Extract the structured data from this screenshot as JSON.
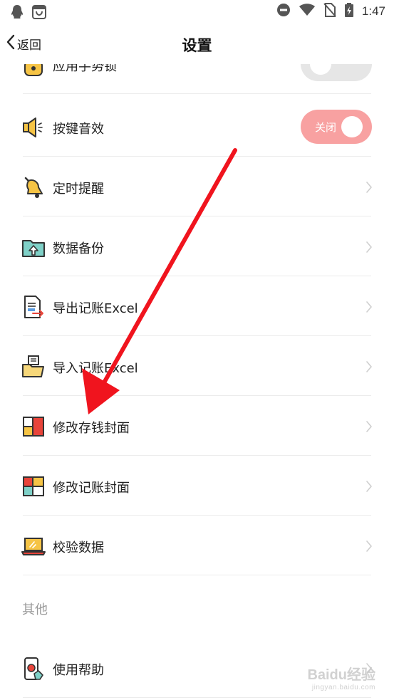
{
  "status_bar": {
    "time": "1:47",
    "icons": [
      "qq-icon",
      "shopping-bag-icon",
      "do-not-disturb-icon",
      "wifi-icon",
      "no-sim-icon",
      "battery-charging-icon"
    ]
  },
  "nav": {
    "back_label": "返回",
    "title": "设置"
  },
  "rows": [
    {
      "label": "应用手势锁",
      "icon": "lock-icon",
      "control": "toggle"
    },
    {
      "label": "按键音效",
      "icon": "speaker-icon",
      "control": "toggle",
      "toggle_text": "关闭"
    },
    {
      "label": "定时提醒",
      "icon": "bell-icon",
      "control": "chevron"
    },
    {
      "label": "数据备份",
      "icon": "folder-upload-icon",
      "control": "chevron"
    },
    {
      "label": "导出记账Excel",
      "icon": "export-document-icon",
      "control": "chevron"
    },
    {
      "label": "导入记账Excel",
      "icon": "import-folder-icon",
      "control": "chevron"
    },
    {
      "label": "修改存钱封面",
      "icon": "savings-cover-icon",
      "control": "chevron"
    },
    {
      "label": "修改记账封面",
      "icon": "ledger-cover-icon",
      "control": "chevron"
    },
    {
      "label": "校验数据",
      "icon": "laptop-icon",
      "control": "chevron"
    }
  ],
  "section_other": "其他",
  "rows_other": [
    {
      "label": "使用帮助",
      "icon": "phone-help-icon",
      "control": "chevron"
    }
  ],
  "colors": {
    "toggle_on": "#f8a1a1",
    "toggle_off": "#e6e6e6",
    "annotation_arrow": "#f0141e"
  },
  "watermark": {
    "text": "Baidu经验",
    "sub": "jingyan.baidu.com"
  }
}
